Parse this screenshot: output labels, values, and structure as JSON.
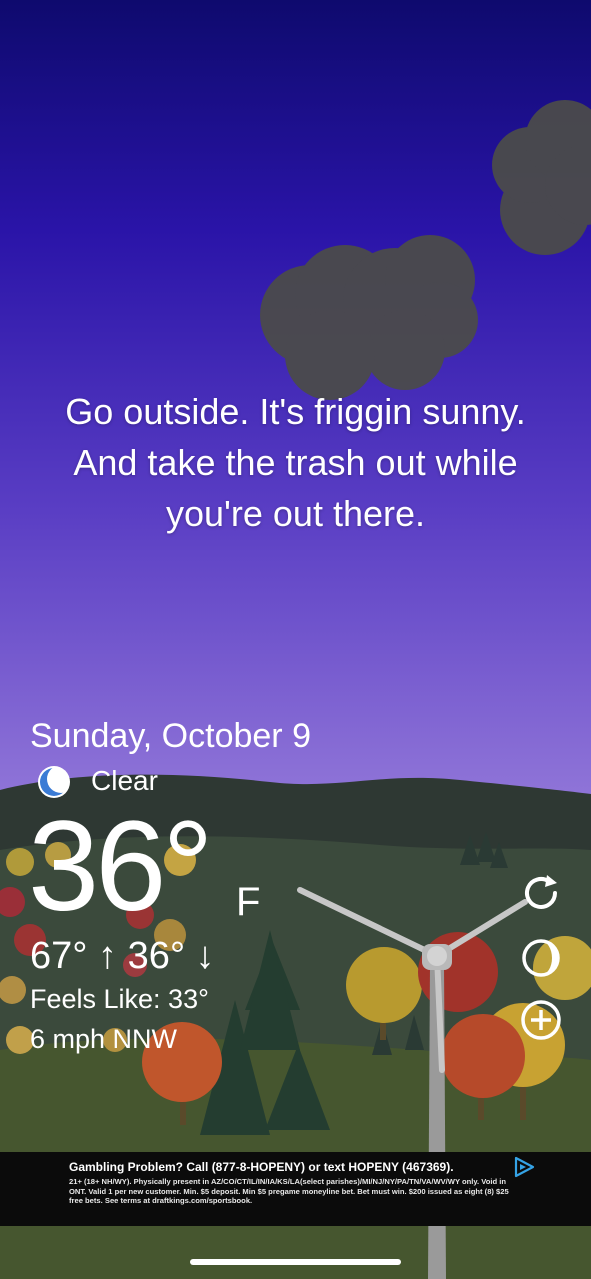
{
  "message": {
    "line1": "Go outside. It's friggin sunny.",
    "line2": "And take the trash out while",
    "line3": "you're out there."
  },
  "weather": {
    "date": "Sunday, October 9",
    "condition_icon": "moon-icon",
    "condition": "Clear",
    "temperature": "36°",
    "unit": "F",
    "high_low": "67° ↑ 36° ↓",
    "feels_like": "Feels Like: 33°",
    "wind": "6 mph NNW"
  },
  "controls": {
    "refresh_icon": "refresh-icon",
    "moon_phase_icon": "moon-phase-icon",
    "add_icon": "add-location-icon"
  },
  "ad": {
    "headline": "Gambling Problem? Call (877-8-HOPENY) or text HOPENY (467369).",
    "body": "21+ (18+ NH/WY). Physically present in AZ/CO/CT/IL/IN/IA/KS/LA(select parishes)/MI/NJ/NY/PA/TN/VA/WV/WY only. Void in ONT. Valid 1 per new customer. Min. $5 deposit. Min $5 pregame moneyline bet. Bet must win. $200 issued as eight (8) $25 free bets. See terms at draftkings.com/sportsbook.",
    "adchoices_icon": "adchoices-icon"
  },
  "colors": {
    "sky_top": "#0e0a6e",
    "sky_bottom": "#b39be6",
    "cloud": "#4a4a4a",
    "hills": "#2f3a33",
    "ad_background": "#0b0b0b"
  }
}
